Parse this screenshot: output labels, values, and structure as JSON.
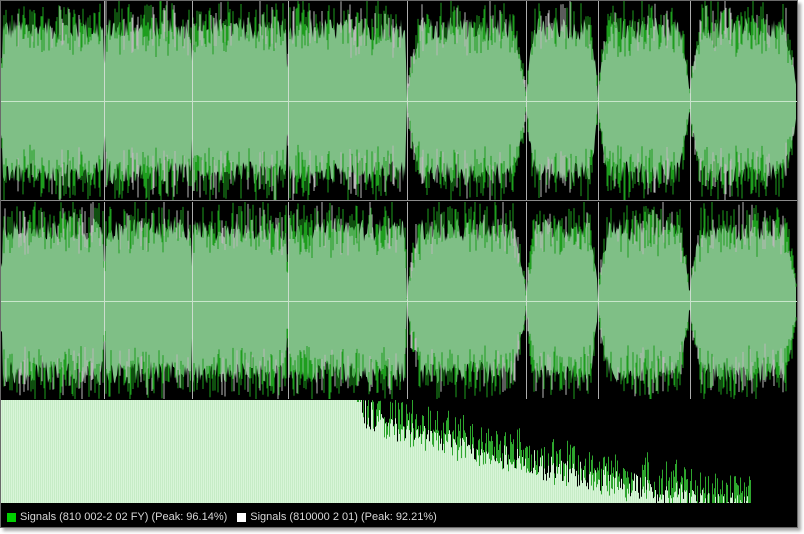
{
  "colors": {
    "background": "#000000",
    "wave_fill": "#7fbf86",
    "wave_edge_green": "#1e9e1e",
    "wave_edge_grey": "#b8b8b8",
    "center_line": "#c9e7cc",
    "spectrum_fill": "#d8f5d8",
    "spectrum_peak": "#2ea62e",
    "legend_green": "#00d000",
    "legend_white": "#ffffff"
  },
  "segments": [
    0.0,
    0.13,
    0.24,
    0.36,
    0.51,
    0.66,
    0.75,
    0.865,
    1.0
  ],
  "legend": {
    "items": [
      {
        "swatch_color": "#00d000",
        "label": "Signals (810 002-2 02 FY) (Peak: 96.14%)"
      },
      {
        "swatch_color": "#ffffff",
        "label": "Signals (810000 2 01) (Peak: 92.21%)"
      }
    ]
  }
}
